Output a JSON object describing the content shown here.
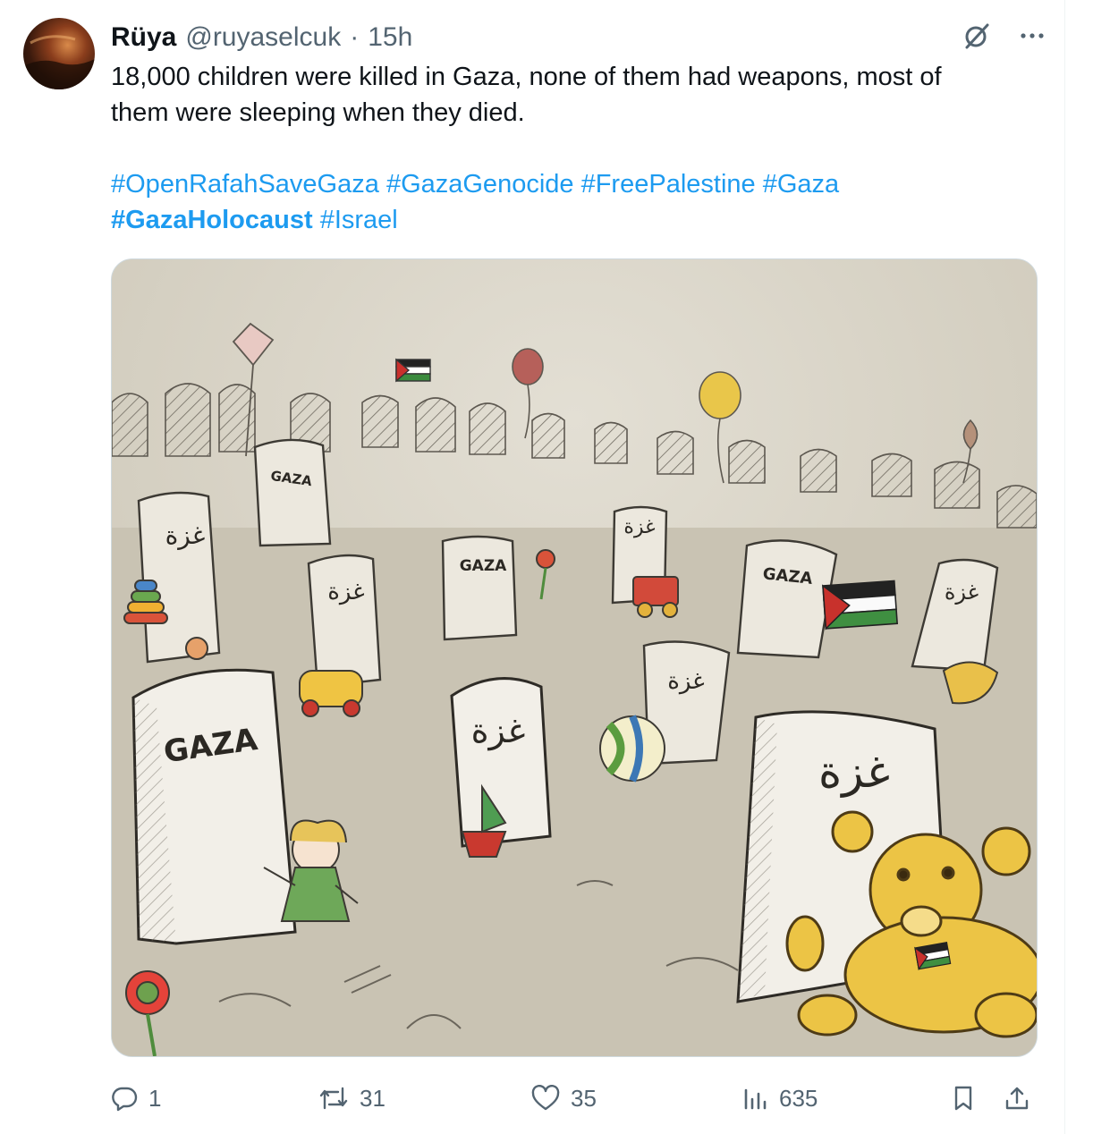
{
  "tweet": {
    "author_name": "Rüya",
    "author_handle": "@ruyaselcuk",
    "separator": "·",
    "time": "15h",
    "text_line1": "18,000 children were killed in Gaza, none of them had weapons, most of",
    "text_line2": "them were sleeping when they died.",
    "hashtags_line1": [
      "#OpenRafahSaveGaza",
      "#GazaGenocide",
      "#FreePalestine",
      "#Gaza"
    ],
    "hashtags_line2": [
      {
        "text": "#GazaHolocaust",
        "bold": true
      },
      {
        "text": "#Israel",
        "bold": false
      }
    ]
  },
  "media": {
    "grave_labels": {
      "gaza": "GAZA",
      "arabic": "غزة"
    }
  },
  "actions": {
    "replies": "1",
    "reposts": "31",
    "likes": "35",
    "views": "635"
  },
  "icons": {
    "top": [
      "grok-icon",
      "more-icon"
    ],
    "bottom": [
      "reply-icon",
      "repost-icon",
      "like-icon",
      "views-icon",
      "bookmark-icon",
      "share-icon"
    ]
  },
  "colors": {
    "link": "#1d9bf0",
    "muted": "#536471",
    "text": "#0f1419"
  }
}
